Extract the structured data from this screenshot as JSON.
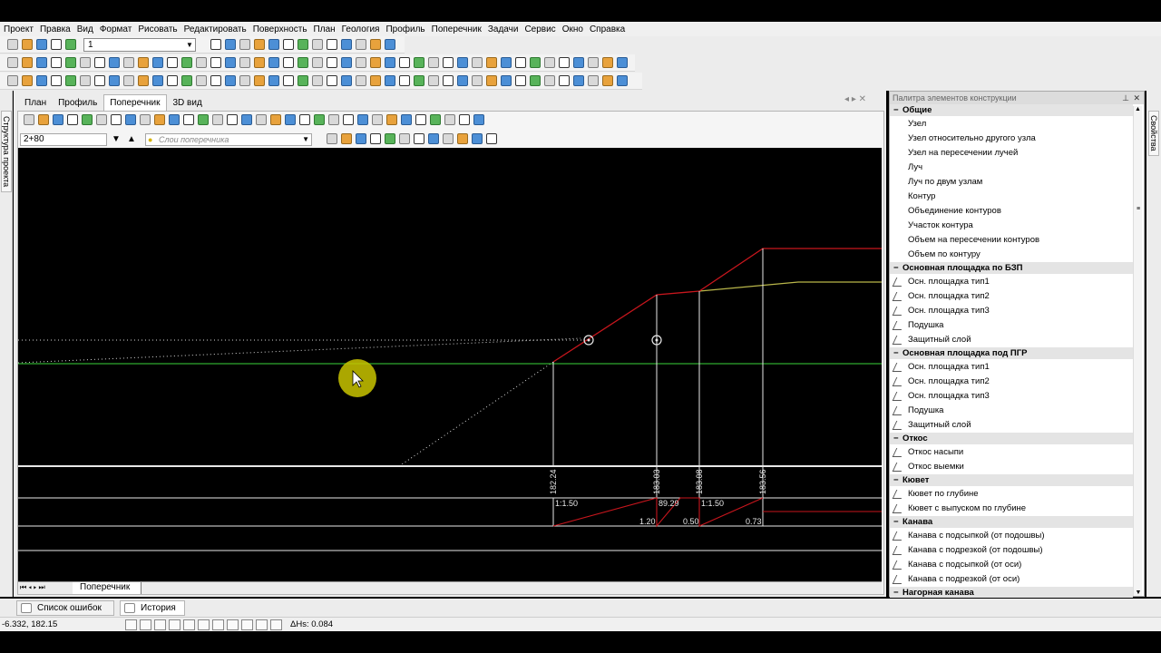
{
  "menu": [
    "Проект",
    "Правка",
    "Вид",
    "Формат",
    "Рисовать",
    "Редактировать",
    "Поверхность",
    "План",
    "Геология",
    "Профиль",
    "Поперечник",
    "Задачи",
    "Сервис",
    "Окно",
    "Справка"
  ],
  "toolbar": {
    "layer_value": "1"
  },
  "left_panel": {
    "tab_label": "Структура проекта"
  },
  "right_panel": {
    "tab_label": "Свойства"
  },
  "doc_tabs": [
    {
      "label": "План",
      "active": false
    },
    {
      "label": "Профиль",
      "active": false
    },
    {
      "label": "Поперечник",
      "active": true
    },
    {
      "label": "3D вид",
      "active": false
    }
  ],
  "cross_section": {
    "station_value": "2+80",
    "layers_placeholder": "Слои поперечника",
    "sheet_tab": "Поперечник",
    "elevations": [
      "182.24",
      "183.03",
      "183.08",
      "183.56"
    ],
    "slope_left": "1:1.50",
    "slope_right": "1:1.50",
    "mid_value": "89.29",
    "bottom_values": [
      "1.20",
      "0.50",
      "0.73"
    ]
  },
  "palette": {
    "title": "Палитра элементов конструкции",
    "categories": [
      {
        "name": "Общие",
        "sign": "−",
        "items": [
          "Узел",
          "Узел относительно другого узла",
          "Узел на пересечении лучей",
          "Луч",
          "Луч по двум узлам",
          "Контур",
          "Объединение контуров",
          "Участок контура",
          "Объем на пересечении контуров",
          "Объем по контуру"
        ],
        "icons": false
      },
      {
        "name": "Основная площадка по БЗП",
        "sign": "−",
        "items": [
          "Осн. площадка тип1",
          "Осн. площадка тип2",
          "Осн. площадка тип3",
          "Подушка",
          "Защитный слой"
        ],
        "icons": true
      },
      {
        "name": "Основная площадка под ПГР",
        "sign": "−",
        "items": [
          "Осн. площадка тип1",
          "Осн. площадка тип2",
          "Осн. площадка тип3",
          "Подушка",
          "Защитный слой"
        ],
        "icons": true
      },
      {
        "name": "Откос",
        "sign": "−",
        "items": [
          "Откос насыпи",
          "Откос выемки"
        ],
        "icons": true
      },
      {
        "name": "Кювет",
        "sign": "−",
        "items": [
          "Кювет по глубине",
          "Кювет с выпуском по глубине"
        ],
        "icons": true
      },
      {
        "name": "Канава",
        "sign": "−",
        "items": [
          "Канава с подсыпкой (от подошвы)",
          "Канава с подрезкой (от подошвы)",
          "Канава с подсыпкой (от оси)",
          "Канава с подрезкой (от оси)"
        ],
        "icons": true
      },
      {
        "name": "Нагорная канава",
        "sign": "−",
        "items": [],
        "icons": true
      }
    ]
  },
  "bottom_tabs": [
    {
      "label": "Список ошибок",
      "active": false
    },
    {
      "label": "История",
      "active": true
    }
  ],
  "status": {
    "coords": "-6.332, 182.15",
    "dh": "ΔHs: 0.084"
  },
  "colors": {
    "design_line": "#c8161d",
    "ground_line": "#2faa2f",
    "existing_line": "#b9b64a",
    "grid_line": "#e8e8e8",
    "cursor_highlight": "#c9c400"
  }
}
